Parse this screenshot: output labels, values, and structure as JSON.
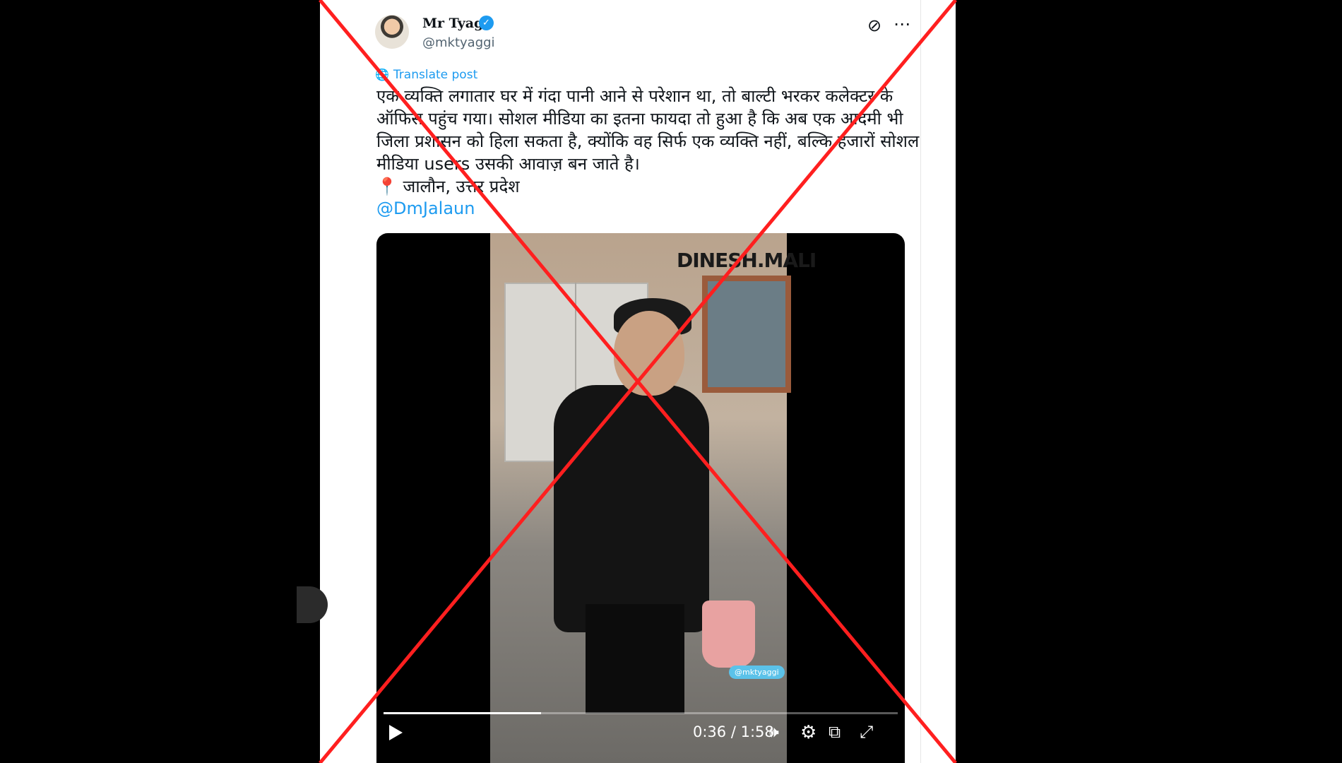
{
  "post": {
    "author_name": "Mr Tyagi",
    "handle": "@mktyaggi",
    "translate_label": "Translate post",
    "text_lines": [
      "एक व्यक्ति लगातार घर में गंदा पानी आने से परेशान था, तो बाल्टी भरकर कलेक्टर के",
      "ऑफिस पहुंच गया। सोशल मीडिया का इतना फायदा तो हुआ है कि अब एक आदमी भी",
      "जिला प्रशासन को हिला सकता है, क्योंकि वह सिर्फ एक व्यक्ति नहीं, बल्कि हजारों सोशल",
      "मीडिया users उसकी आवाज़ बन जाते है।"
    ],
    "location_pin": "📍",
    "location": "जालौन, उत्तर प्रदेश",
    "mention": "@DmJalaun"
  },
  "video": {
    "watermark": "DINESH.MALI",
    "tag": "@mktyaggi",
    "time": "0:36 / 1:58",
    "progress": 0.307
  },
  "icons": {
    "verified": "verified-badge-icon",
    "grok": "grok-icon",
    "more": "more-icon",
    "play": "play-icon",
    "volume": "volume-icon",
    "settings": "settings-icon",
    "popout": "popout-icon",
    "fullscreen": "fullscreen-icon"
  },
  "colors": {
    "accent": "#1d9bf0",
    "cross": "#ff1f1f"
  }
}
